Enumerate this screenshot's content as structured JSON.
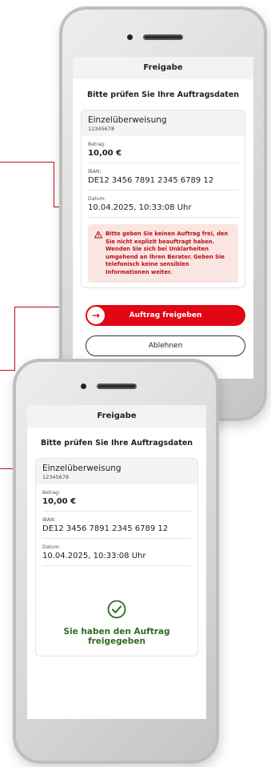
{
  "phone_pending": {
    "topbar_title": "Freigabe",
    "headline": "Bitte prüfen Sie Ihre Auftragsdaten",
    "card_title": "Einzelüberweisung",
    "card_number": "12345678",
    "fields": [
      {
        "label": "Betrag:",
        "value": "10,00 €"
      },
      {
        "label": "IBAN:",
        "value": "DE12 3456 7891 2345 6789 12"
      },
      {
        "label": "Datum:",
        "value": "10.04.2025, 10:33:08 Uhr"
      }
    ],
    "warning_text": "Bitte geben Sie keinen Auftrag frei, den Sie nicht explizit beauftragt haben. Wenden Sie sich bei Unklarheiten umgehend an Ihren Berater. Geben Sie telefonisch keine sensiblen Informationen weiter.",
    "approve_label": "Auftrag freigeben",
    "approve_arrow": "→",
    "decline_label": "Ablehnen"
  },
  "phone_done": {
    "topbar_title": "Freigabe",
    "headline": "Bitte prüfen Sie Ihre Auftragsdaten",
    "card_title": "Einzelüberweisung",
    "card_number": "12345678",
    "fields": [
      {
        "label": "Betrag:",
        "value": "10,00 €"
      },
      {
        "label": "IBAN:",
        "value": "DE12 3456 7891 2345 6789 12"
      },
      {
        "label": "Datum:",
        "value": "10.04.2025, 10:33:08 Uhr"
      }
    ],
    "success_text": "Sie haben den Auftrag freigegeben"
  },
  "colors": {
    "brand_red": "#e30613",
    "warning_bg": "#fbe5e2",
    "success_green": "#2e6b1f",
    "connector": "#b5121b"
  },
  "icons": {
    "warning": "warning-triangle-icon",
    "arrow": "arrow-right-icon",
    "success": "check-circle-icon"
  }
}
